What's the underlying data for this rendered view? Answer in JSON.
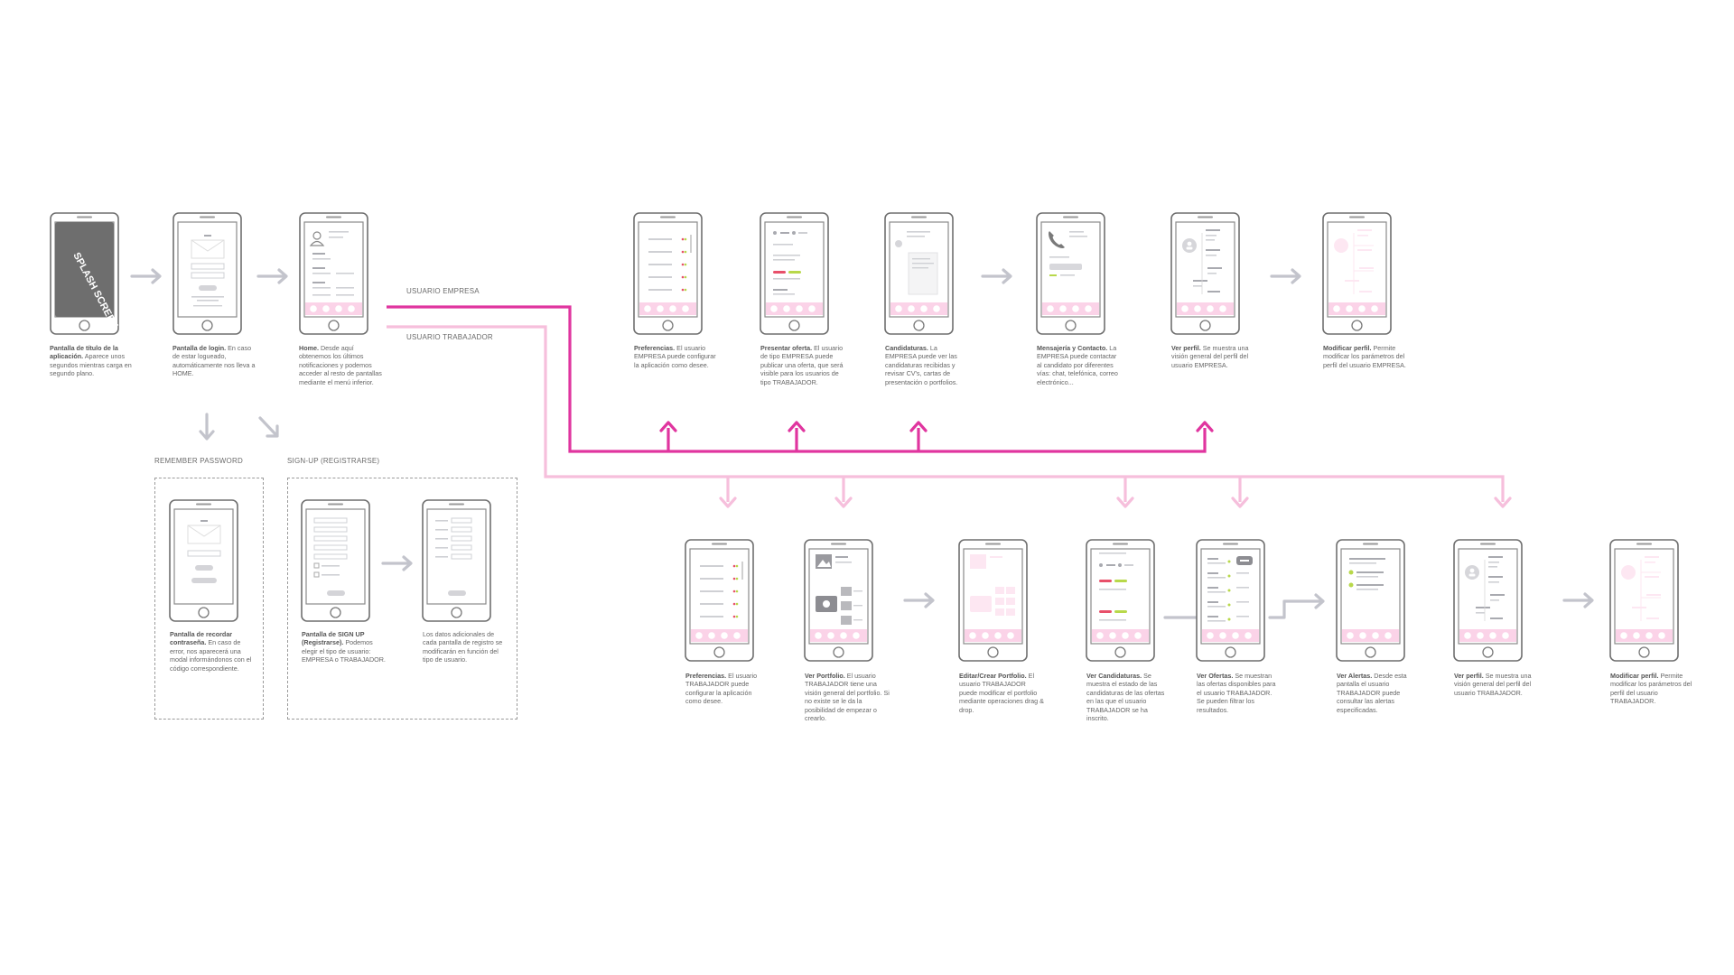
{
  "colors": {
    "empresa_line": "#e0359f",
    "trabajador_line": "#f6bfdc",
    "nav_bar": "#fbd3e8",
    "splash_screen": "#6e6e6e",
    "arrow_gray": "#c3c4cc",
    "red_pill": "#e8506a",
    "green_pill": "#b8d84a",
    "text_gray": "#666666"
  },
  "flow_labels": {
    "empresa": "USUARIO EMPRESA",
    "trabajador": "USUARIO TRABAJADOR"
  },
  "group_labels": {
    "remember": "REMEMBER PASSWORD",
    "signup": "SIGN-UP (REGISTRARSE)"
  },
  "splash_text": "SPLASH SCREEN",
  "screens": {
    "splash": {
      "title": "Pantalla de título de la aplicación.",
      "text": " Aparece unos segundos mientras carga en segundo plano."
    },
    "login": {
      "title": "Pantalla de login.",
      "text": " En caso de estar logueado, automáticamente nos lleva a HOME."
    },
    "home": {
      "title": "Home.",
      "text": " Desde aquí obtenemos los últimos notificaciones y podemos acceder al resto de pantallas mediante el menú inferior."
    },
    "remember": {
      "title": "Pantalla de recordar contraseña.",
      "text": " En caso de error, nos aparecerá una modal informándonos con el código correspondiente."
    },
    "signup": {
      "title": "Pantalla de SIGN UP (Registrarse).",
      "text": " Podemos elegir el tipo de usuario: EMPRESA o TRABAJADOR."
    },
    "signup_extra": {
      "title": "",
      "text": "Los datos adicionales de cada pantalla de registro se modificarán en función del tipo de usuario."
    },
    "e_pref": {
      "title": "Preferencias.",
      "text": " El usuario EMPRESA puede configurar la aplicación como desee."
    },
    "e_oferta": {
      "title": "Presentar oferta.",
      "text": " El usuario de tipo EMPRESA puede publicar una oferta, que será visible para los usuarios de tipo TRABAJADOR."
    },
    "e_cand": {
      "title": "Candidaturas.",
      "text": " La EMPRESA puede ver las candidaturas recibidas y revisar CV's, cartas de presentación o portfolios."
    },
    "e_msg": {
      "title": "Mensajería y Contacto.",
      "text": " La EMPRESA puede contactar al candidato por diferentes vías: chat, telefónica, correo electrónico..."
    },
    "e_perfil": {
      "title": "Ver perfil.",
      "text": " Se muestra una visión general del perfil del usuario EMPRESA."
    },
    "e_mod": {
      "title": "Modificar perfil.",
      "text": " Permite modificar los parámetros del perfil del usuario EMPRESA."
    },
    "t_pref": {
      "title": "Preferencias.",
      "text": " El usuario TRABAJADOR puede configurar la aplicación como desee."
    },
    "t_portfolio": {
      "title": "Ver Portfolio.",
      "text": " El usuario TRABAJADOR tiene una visión general del portfolio. Si no existe se le da la posibilidad de empezar o crearlo."
    },
    "t_editar": {
      "title": "Editar/Crear Portfolio.",
      "text": " El usuario TRABAJADOR puede modificar el portfolio mediante operaciones drag & drop."
    },
    "t_cand": {
      "title": "Ver Candidaturas.",
      "text": " Se muestra el estado de las candidaturas de las ofertas en las que el usuario TRABAJADOR se ha inscrito."
    },
    "t_ofertas": {
      "title": "Ver Ofertas.",
      "text": " Se muestran las ofertas disponibles para el usuario TRABAJADOR. Se pueden filtrar los resultados."
    },
    "t_alertas": {
      "title": "Ver Alertas.",
      "text": " Desde esta pantalla el usuario TRABAJADOR puede consultar las alertas especificadas."
    },
    "t_perfil": {
      "title": "Ver perfil.",
      "text": " Se muestra una visión general del perfil del usuario TRABAJADOR."
    },
    "t_mod": {
      "title": "Modificar perfil.",
      "text": " Permite modificar los parámetros del perfil del usuario TRABAJADOR."
    }
  }
}
